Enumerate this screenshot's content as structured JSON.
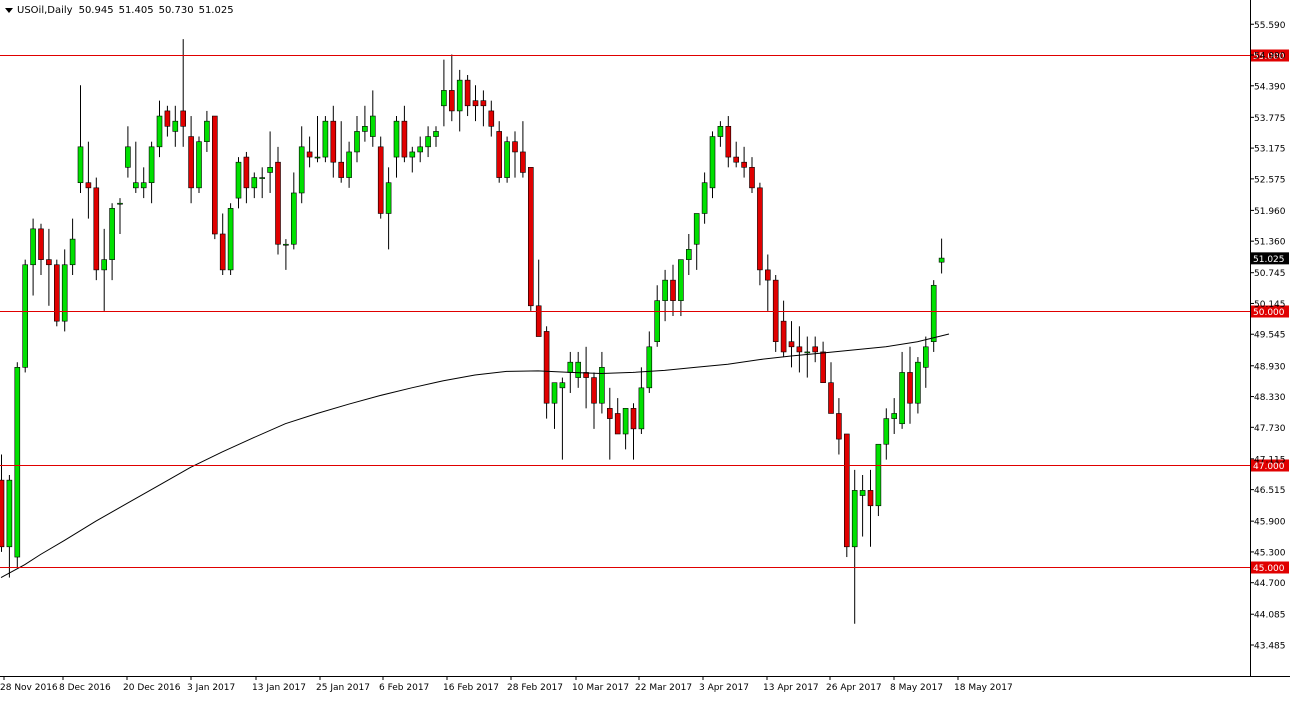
{
  "header": {
    "symbol": "USOil,Daily",
    "open": "50.945",
    "high": "51.405",
    "low": "50.730",
    "close": "51.025"
  },
  "colors": {
    "bull": "#00e000",
    "bear": "#e00000",
    "wick": "#000000",
    "level_line": "#e00000",
    "ma_line": "#000000",
    "background": "#ffffff",
    "price_tag": "#000000"
  },
  "chart_data": {
    "type": "candlestick",
    "ylim": [
      43.485,
      55.79
    ],
    "y_ticks": [
      "55.590",
      "54.990",
      "54.390",
      "53.775",
      "53.175",
      "52.575",
      "51.960",
      "51.360",
      "50.745",
      "50.145",
      "49.545",
      "48.930",
      "48.330",
      "47.730",
      "47.115",
      "46.515",
      "45.900",
      "45.300",
      "44.700",
      "44.085",
      "43.485"
    ],
    "x_ticks": [
      "28 Nov 2016",
      "8 Dec 2016",
      "20 Dec 2016",
      "3 Jan 2017",
      "13 Jan 2017",
      "25 Jan 2017",
      "6 Feb 2017",
      "16 Feb 2017",
      "28 Feb 2017",
      "10 Mar 2017",
      "22 Mar 2017",
      "3 Apr 2017",
      "13 Apr 2017",
      "26 Apr 2017",
      "8 May 2017",
      "18 May 2017"
    ],
    "levels": [
      {
        "value": 55.0,
        "label": "55.000"
      },
      {
        "value": 50.0,
        "label": "50.000"
      },
      {
        "value": 47.0,
        "label": "47.000"
      },
      {
        "value": 45.0,
        "label": "45.000"
      }
    ],
    "current_price": {
      "value": 51.025,
      "label": "51.025"
    },
    "grid": false,
    "candles": [
      {
        "o": 46.7,
        "h": 47.2,
        "l": 45.3,
        "c": 45.4
      },
      {
        "o": 45.4,
        "h": 46.8,
        "l": 44.8,
        "c": 46.7
      },
      {
        "o": 45.2,
        "h": 49.0,
        "l": 45.0,
        "c": 48.9
      },
      {
        "o": 48.9,
        "h": 51.0,
        "l": 48.8,
        "c": 50.9
      },
      {
        "o": 50.9,
        "h": 51.8,
        "l": 50.3,
        "c": 51.6
      },
      {
        "o": 51.6,
        "h": 51.7,
        "l": 50.7,
        "c": 51.0
      },
      {
        "o": 51.0,
        "h": 51.6,
        "l": 50.1,
        "c": 50.9
      },
      {
        "o": 50.9,
        "h": 51.0,
        "l": 49.7,
        "c": 49.8
      },
      {
        "o": 49.8,
        "h": 51.2,
        "l": 49.6,
        "c": 50.9
      },
      {
        "o": 50.9,
        "h": 51.8,
        "l": 50.7,
        "c": 51.4
      },
      {
        "o": 52.5,
        "h": 54.4,
        "l": 52.3,
        "c": 53.2
      },
      {
        "o": 52.5,
        "h": 53.3,
        "l": 51.8,
        "c": 52.4
      },
      {
        "o": 52.4,
        "h": 52.6,
        "l": 50.6,
        "c": 50.8
      },
      {
        "o": 50.8,
        "h": 51.6,
        "l": 50.0,
        "c": 51.0
      },
      {
        "o": 51.0,
        "h": 52.1,
        "l": 50.6,
        "c": 52.0
      },
      {
        "o": 52.1,
        "h": 52.2,
        "l": 51.5,
        "c": 52.1
      },
      {
        "o": 52.8,
        "h": 53.6,
        "l": 52.6,
        "c": 53.2
      },
      {
        "o": 52.4,
        "h": 53.3,
        "l": 52.3,
        "c": 52.5
      },
      {
        "o": 52.4,
        "h": 52.8,
        "l": 52.2,
        "c": 52.5
      },
      {
        "o": 52.5,
        "h": 53.3,
        "l": 52.1,
        "c": 53.2
      },
      {
        "o": 53.2,
        "h": 54.1,
        "l": 53.0,
        "c": 53.8
      },
      {
        "o": 53.9,
        "h": 54.0,
        "l": 53.4,
        "c": 53.6
      },
      {
        "o": 53.5,
        "h": 54.0,
        "l": 53.2,
        "c": 53.7
      },
      {
        "o": 53.9,
        "h": 55.3,
        "l": 53.2,
        "c": 53.6
      },
      {
        "o": 53.4,
        "h": 53.8,
        "l": 52.1,
        "c": 52.4
      },
      {
        "o": 52.4,
        "h": 53.4,
        "l": 52.3,
        "c": 53.3
      },
      {
        "o": 53.3,
        "h": 53.9,
        "l": 53.1,
        "c": 53.7
      },
      {
        "o": 53.8,
        "h": 53.8,
        "l": 51.4,
        "c": 51.5
      },
      {
        "o": 51.5,
        "h": 51.9,
        "l": 50.7,
        "c": 50.8
      },
      {
        "o": 50.8,
        "h": 52.1,
        "l": 50.7,
        "c": 52.0
      },
      {
        "o": 52.2,
        "h": 53.0,
        "l": 52.0,
        "c": 52.9
      },
      {
        "o": 53.0,
        "h": 53.1,
        "l": 52.1,
        "c": 52.4
      },
      {
        "o": 52.4,
        "h": 52.7,
        "l": 52.2,
        "c": 52.6
      },
      {
        "o": 52.6,
        "h": 52.8,
        "l": 52.2,
        "c": 52.6
      },
      {
        "o": 52.7,
        "h": 53.5,
        "l": 52.3,
        "c": 52.8
      },
      {
        "o": 52.9,
        "h": 53.2,
        "l": 51.1,
        "c": 51.3
      },
      {
        "o": 51.3,
        "h": 51.4,
        "l": 50.8,
        "c": 51.3
      },
      {
        "o": 51.3,
        "h": 52.7,
        "l": 51.2,
        "c": 52.3
      },
      {
        "o": 52.3,
        "h": 53.6,
        "l": 52.1,
        "c": 53.2
      },
      {
        "o": 53.1,
        "h": 53.4,
        "l": 52.8,
        "c": 53.0
      },
      {
        "o": 53.0,
        "h": 53.8,
        "l": 52.9,
        "c": 53.0
      },
      {
        "o": 53.0,
        "h": 53.8,
        "l": 52.9,
        "c": 53.7
      },
      {
        "o": 53.7,
        "h": 54.0,
        "l": 52.6,
        "c": 52.9
      },
      {
        "o": 52.9,
        "h": 53.7,
        "l": 52.5,
        "c": 52.6
      },
      {
        "o": 52.6,
        "h": 53.3,
        "l": 52.4,
        "c": 53.1
      },
      {
        "o": 53.1,
        "h": 53.8,
        "l": 52.9,
        "c": 53.5
      },
      {
        "o": 53.5,
        "h": 54.0,
        "l": 53.3,
        "c": 53.6
      },
      {
        "o": 53.4,
        "h": 54.3,
        "l": 53.2,
        "c": 53.8
      },
      {
        "o": 53.2,
        "h": 53.4,
        "l": 51.8,
        "c": 51.9
      },
      {
        "o": 51.9,
        "h": 52.8,
        "l": 51.2,
        "c": 52.5
      },
      {
        "o": 53.0,
        "h": 53.8,
        "l": 52.6,
        "c": 53.7
      },
      {
        "o": 53.7,
        "h": 54.0,
        "l": 52.9,
        "c": 53.0
      },
      {
        "o": 53.0,
        "h": 53.2,
        "l": 52.7,
        "c": 53.1
      },
      {
        "o": 53.1,
        "h": 53.4,
        "l": 52.9,
        "c": 53.2
      },
      {
        "o": 53.2,
        "h": 53.6,
        "l": 53.0,
        "c": 53.4
      },
      {
        "o": 53.4,
        "h": 53.6,
        "l": 53.2,
        "c": 53.5
      },
      {
        "o": 54.0,
        "h": 54.9,
        "l": 53.6,
        "c": 54.3
      },
      {
        "o": 54.3,
        "h": 55.0,
        "l": 53.7,
        "c": 53.9
      },
      {
        "o": 53.9,
        "h": 54.7,
        "l": 53.5,
        "c": 54.5
      },
      {
        "o": 54.5,
        "h": 54.6,
        "l": 53.8,
        "c": 54.0
      },
      {
        "o": 54.1,
        "h": 54.4,
        "l": 53.7,
        "c": 54.0
      },
      {
        "o": 54.1,
        "h": 54.3,
        "l": 53.6,
        "c": 54.0
      },
      {
        "o": 53.9,
        "h": 54.1,
        "l": 53.4,
        "c": 53.6
      },
      {
        "o": 53.5,
        "h": 53.7,
        "l": 52.5,
        "c": 52.6
      },
      {
        "o": 52.6,
        "h": 53.4,
        "l": 52.5,
        "c": 53.3
      },
      {
        "o": 53.3,
        "h": 53.5,
        "l": 52.6,
        "c": 53.1
      },
      {
        "o": 53.1,
        "h": 53.7,
        "l": 52.6,
        "c": 52.7
      },
      {
        "o": 52.8,
        "h": 52.8,
        "l": 50.0,
        "c": 50.1
      },
      {
        "o": 50.1,
        "h": 51.0,
        "l": 49.7,
        "c": 49.5
      },
      {
        "o": 49.6,
        "h": 49.7,
        "l": 47.9,
        "c": 48.2
      },
      {
        "o": 48.2,
        "h": 48.6,
        "l": 47.7,
        "c": 48.6
      },
      {
        "o": 48.5,
        "h": 48.7,
        "l": 47.1,
        "c": 48.6
      },
      {
        "o": 48.8,
        "h": 49.2,
        "l": 48.4,
        "c": 49.0
      },
      {
        "o": 48.7,
        "h": 49.2,
        "l": 48.5,
        "c": 49.0
      },
      {
        "o": 48.8,
        "h": 49.3,
        "l": 48.1,
        "c": 48.7
      },
      {
        "o": 48.7,
        "h": 48.8,
        "l": 47.7,
        "c": 48.2
      },
      {
        "o": 48.2,
        "h": 49.2,
        "l": 48.0,
        "c": 48.9
      },
      {
        "o": 48.1,
        "h": 48.5,
        "l": 47.1,
        "c": 47.9
      },
      {
        "o": 48.0,
        "h": 48.3,
        "l": 47.6,
        "c": 47.6
      },
      {
        "o": 47.6,
        "h": 48.1,
        "l": 47.3,
        "c": 48.1
      },
      {
        "o": 48.1,
        "h": 48.2,
        "l": 47.1,
        "c": 47.7
      },
      {
        "o": 47.7,
        "h": 48.9,
        "l": 47.6,
        "c": 48.5
      },
      {
        "o": 48.5,
        "h": 49.6,
        "l": 48.4,
        "c": 49.3
      },
      {
        "o": 49.4,
        "h": 50.5,
        "l": 49.3,
        "c": 50.2
      },
      {
        "o": 50.2,
        "h": 50.8,
        "l": 49.8,
        "c": 50.6
      },
      {
        "o": 50.6,
        "h": 50.9,
        "l": 49.9,
        "c": 50.2
      },
      {
        "o": 50.2,
        "h": 50.8,
        "l": 49.9,
        "c": 51.0
      },
      {
        "o": 51.0,
        "h": 51.5,
        "l": 50.7,
        "c": 51.2
      },
      {
        "o": 51.3,
        "h": 51.8,
        "l": 50.8,
        "c": 51.9
      },
      {
        "o": 51.9,
        "h": 52.7,
        "l": 51.7,
        "c": 52.5
      },
      {
        "o": 52.4,
        "h": 53.5,
        "l": 52.2,
        "c": 53.4
      },
      {
        "o": 53.4,
        "h": 53.7,
        "l": 53.2,
        "c": 53.6
      },
      {
        "o": 53.6,
        "h": 53.8,
        "l": 52.8,
        "c": 53.0
      },
      {
        "o": 53.0,
        "h": 53.3,
        "l": 52.8,
        "c": 52.9
      },
      {
        "o": 52.9,
        "h": 53.2,
        "l": 52.6,
        "c": 52.8
      },
      {
        "o": 52.8,
        "h": 53.0,
        "l": 52.3,
        "c": 52.4
      },
      {
        "o": 52.4,
        "h": 52.5,
        "l": 50.5,
        "c": 50.8
      },
      {
        "o": 50.8,
        "h": 51.1,
        "l": 50.0,
        "c": 50.6
      },
      {
        "o": 50.6,
        "h": 50.7,
        "l": 49.2,
        "c": 49.4
      },
      {
        "o": 49.8,
        "h": 50.2,
        "l": 49.1,
        "c": 49.2
      },
      {
        "o": 49.4,
        "h": 49.8,
        "l": 48.9,
        "c": 49.3
      },
      {
        "o": 49.3,
        "h": 49.7,
        "l": 48.8,
        "c": 49.2
      },
      {
        "o": 49.2,
        "h": 49.5,
        "l": 48.7,
        "c": 49.2
      },
      {
        "o": 49.3,
        "h": 49.5,
        "l": 49.0,
        "c": 49.2
      },
      {
        "o": 49.2,
        "h": 49.4,
        "l": 48.6,
        "c": 48.6
      },
      {
        "o": 48.6,
        "h": 49.0,
        "l": 48.0,
        "c": 48.0
      },
      {
        "o": 48.0,
        "h": 48.3,
        "l": 47.2,
        "c": 47.5
      },
      {
        "o": 47.6,
        "h": 47.6,
        "l": 45.2,
        "c": 45.4
      },
      {
        "o": 45.4,
        "h": 46.9,
        "l": 43.9,
        "c": 46.5
      },
      {
        "o": 46.4,
        "h": 46.8,
        "l": 45.6,
        "c": 46.5
      },
      {
        "o": 46.5,
        "h": 46.9,
        "l": 45.4,
        "c": 46.2
      },
      {
        "o": 46.2,
        "h": 47.4,
        "l": 46.0,
        "c": 47.4
      },
      {
        "o": 47.4,
        "h": 48.1,
        "l": 47.1,
        "c": 47.9
      },
      {
        "o": 47.9,
        "h": 48.3,
        "l": 47.6,
        "c": 48.0
      },
      {
        "o": 47.8,
        "h": 49.2,
        "l": 47.7,
        "c": 48.8
      },
      {
        "o": 48.8,
        "h": 49.3,
        "l": 47.8,
        "c": 48.2
      },
      {
        "o": 48.2,
        "h": 49.1,
        "l": 48.0,
        "c": 49.0
      },
      {
        "o": 48.9,
        "h": 49.5,
        "l": 48.5,
        "c": 49.3
      },
      {
        "o": 49.4,
        "h": 50.6,
        "l": 49.2,
        "c": 50.5
      },
      {
        "o": 50.95,
        "h": 51.41,
        "l": 50.73,
        "c": 51.03
      }
    ],
    "ma_line": [
      {
        "i": 0,
        "v": 44.8
      },
      {
        "i": 3,
        "v": 45.05
      },
      {
        "i": 5,
        "v": 45.25
      },
      {
        "i": 8,
        "v": 45.52
      },
      {
        "i": 12,
        "v": 45.9
      },
      {
        "i": 16,
        "v": 46.25
      },
      {
        "i": 20,
        "v": 46.6
      },
      {
        "i": 24,
        "v": 46.95
      },
      {
        "i": 28,
        "v": 47.25
      },
      {
        "i": 32,
        "v": 47.53
      },
      {
        "i": 36,
        "v": 47.8
      },
      {
        "i": 40,
        "v": 48.0
      },
      {
        "i": 44,
        "v": 48.18
      },
      {
        "i": 48,
        "v": 48.35
      },
      {
        "i": 52,
        "v": 48.5
      },
      {
        "i": 56,
        "v": 48.64
      },
      {
        "i": 60,
        "v": 48.75
      },
      {
        "i": 64,
        "v": 48.82
      },
      {
        "i": 68,
        "v": 48.83
      },
      {
        "i": 72,
        "v": 48.8
      },
      {
        "i": 76,
        "v": 48.78
      },
      {
        "i": 80,
        "v": 48.8
      },
      {
        "i": 84,
        "v": 48.84
      },
      {
        "i": 88,
        "v": 48.9
      },
      {
        "i": 92,
        "v": 48.96
      },
      {
        "i": 96,
        "v": 49.05
      },
      {
        "i": 100,
        "v": 49.12
      },
      {
        "i": 104,
        "v": 49.18
      },
      {
        "i": 108,
        "v": 49.24
      },
      {
        "i": 112,
        "v": 49.3
      },
      {
        "i": 116,
        "v": 49.4
      },
      {
        "i": 120,
        "v": 49.55
      }
    ]
  }
}
